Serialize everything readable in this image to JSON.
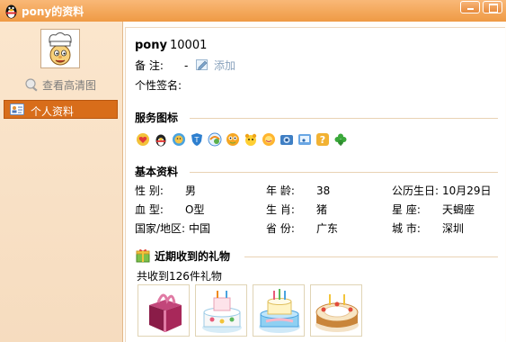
{
  "window": {
    "title": "pony的资料"
  },
  "sidebar": {
    "view_hd": "查看高清图",
    "items": [
      {
        "label": "个人资料",
        "selected": true
      }
    ]
  },
  "profile": {
    "name": "pony",
    "qq": "10001",
    "remark_label": "备    注:",
    "remark_value": "-",
    "remark_action": "添加",
    "signature_label": "个性签名:"
  },
  "services": {
    "title": "服务图标",
    "icons": [
      "qq-love-icon",
      "qq-penguin-icon",
      "qq-member-icon",
      "qq-security-icon",
      "qq-mail-icon",
      "qq-game-icon",
      "qq-pet-icon",
      "qq-show-icon",
      "qq-camera-icon",
      "qq-music-icon",
      "qq-question-icon",
      "clover-icon"
    ]
  },
  "basic": {
    "title": "基本资料",
    "rows": [
      [
        {
          "label": "性    别:",
          "value": "男"
        },
        {
          "label": "年    龄:",
          "value": "38"
        },
        {
          "label": "公历生日:",
          "value": "10月29日"
        }
      ],
      [
        {
          "label": "血    型:",
          "value": "O型"
        },
        {
          "label": "生    肖:",
          "value": "猪"
        },
        {
          "label": "星    座:",
          "value": "天蝎座"
        }
      ],
      [
        {
          "label": "国家/地区:",
          "value": "中国"
        },
        {
          "label": "省    份:",
          "value": "广东"
        },
        {
          "label": "城    市:",
          "value": "深圳"
        }
      ]
    ]
  },
  "gifts": {
    "title": "近期收到的礼物",
    "summary": "共收到126件礼物",
    "items": [
      "gift-box-icon",
      "birthday-cake-icon",
      "birthday-cake-icon",
      "birthday-cake-icon"
    ]
  },
  "colors": {
    "titlebar": "#ef9a44",
    "accent": "#d86d1a",
    "panel": "#fbe6cd"
  }
}
